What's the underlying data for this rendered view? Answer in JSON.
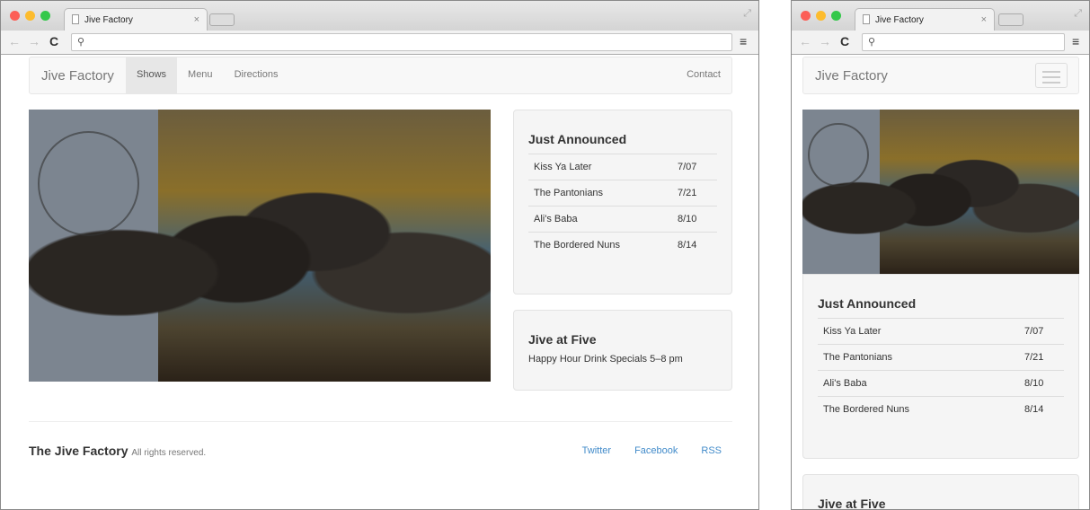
{
  "browser": {
    "tab_title": "Jive Factory",
    "close": "×",
    "back": "←",
    "forward": "→",
    "reload": "C",
    "search_icon": "⚲",
    "menu": "≡",
    "resize": "⤢"
  },
  "site": {
    "brand": "Jive Factory",
    "nav": [
      {
        "label": "Shows",
        "active": true
      },
      {
        "label": "Menu"
      },
      {
        "label": "Directions"
      }
    ],
    "contact": "Contact",
    "announced": {
      "title": "Just Announced",
      "shows": [
        {
          "name": "Kiss Ya Later",
          "date": "7/07"
        },
        {
          "name": "The Pantonians",
          "date": "7/21"
        },
        {
          "name": "Ali's Baba",
          "date": "8/10"
        },
        {
          "name": "The Bordered Nuns",
          "date": "8/14"
        }
      ]
    },
    "jive_at_five": {
      "title": "Jive at Five",
      "text": "Happy Hour Drink Specials 5–8 pm"
    },
    "footer": {
      "name": "The Jive Factory",
      "rights": "All rights reserved.",
      "links": [
        "Twitter",
        "Facebook",
        "RSS"
      ]
    }
  }
}
